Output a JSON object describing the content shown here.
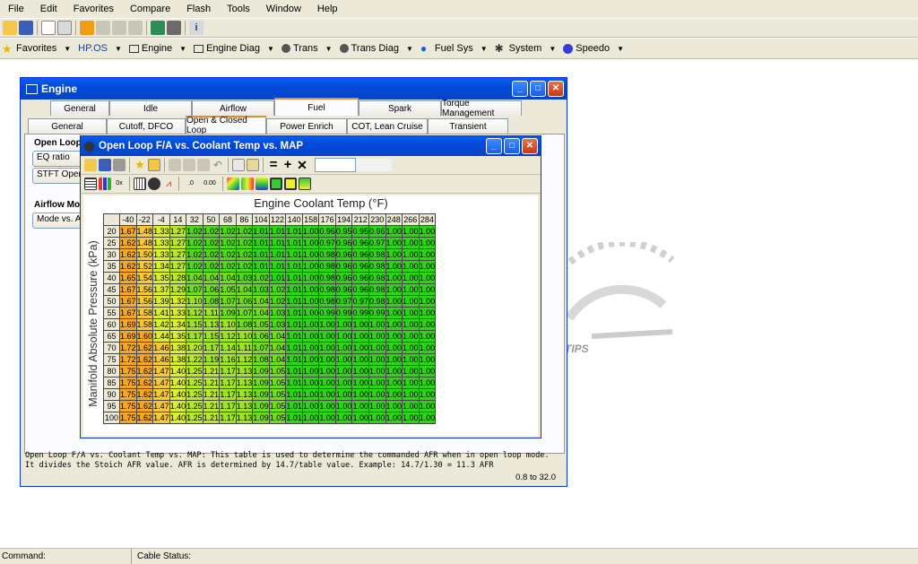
{
  "menu": [
    "File",
    "Edit",
    "Favorites",
    "Compare",
    "Flash",
    "Tools",
    "Window",
    "Help"
  ],
  "nav": [
    "Favorites",
    "HP.OS",
    "Engine",
    "Engine Diag",
    "Trans",
    "Trans Diag",
    "Fuel Sys",
    "System",
    "Speedo"
  ],
  "engine_window": {
    "title": "Engine",
    "tabs_main": [
      "General",
      "Idle",
      "Airflow",
      "Fuel",
      "Spark",
      "Torque Management"
    ],
    "active_main": "Fuel",
    "tabs_sub": [
      "General",
      "Cutoff, DFCO",
      "Open & Closed Loop",
      "Power Enrich",
      "COT, Lean Cruise",
      "Transient"
    ],
    "active_sub": "Open & Closed Loop",
    "section_open_loop": "Open Loop",
    "btn_eq_ratio": "EQ ratio",
    "btn_stft": "STFT Openlo",
    "section_airflow": "Airflow Mo",
    "btn_mode": "Mode vs. A",
    "description": "Open Loop F/A vs. Coolant Temp vs. MAP: This table is used to determine the commanded AFR when in open loop mode. It divides the Stoich AFR value. AFR is determined by 14.7/table value. Example: 14.7/1.30 = 11.3 AFR",
    "range": "0.8 to 32.0"
  },
  "table_window": {
    "title": "Open Loop F/A vs. Coolant Temp vs. MAP",
    "x_label": "Engine Coolant Temp (°F)",
    "y_label": "Manifold Absolute Pressure (kPa)",
    "columns": [
      "-40",
      "-22",
      "-4",
      "14",
      "32",
      "50",
      "68",
      "86",
      "104",
      "122",
      "140",
      "158",
      "176",
      "194",
      "212",
      "230",
      "248",
      "266",
      "284"
    ],
    "rows": [
      {
        "kpa": "20",
        "v": [
          "1.67",
          "1.48",
          "1.33",
          "1.27",
          "1.02",
          "1.02",
          "1.02",
          "1.02",
          "1.01",
          "1.01",
          "1.01",
          "1.00",
          "0.96",
          "0.95",
          "0.95",
          "0.96",
          "1.00",
          "1.00",
          "1.00"
        ]
      },
      {
        "kpa": "25",
        "v": [
          "1.62",
          "1.48",
          "1.33",
          "1.27",
          "1.02",
          "1.02",
          "1.02",
          "1.02",
          "1.01",
          "1.01",
          "1.01",
          "1.00",
          "0.97",
          "0.96",
          "0.96",
          "0.97",
          "1.00",
          "1.00",
          "1.00"
        ]
      },
      {
        "kpa": "30",
        "v": [
          "1.62",
          "1.50",
          "1.33",
          "1.27",
          "1.02",
          "1.02",
          "1.02",
          "1.02",
          "1.01",
          "1.01",
          "1.01",
          "1.00",
          "0.98",
          "0.96",
          "0.96",
          "0.98",
          "1.00",
          "1.00",
          "1.00"
        ]
      },
      {
        "kpa": "35",
        "v": [
          "1.62",
          "1.52",
          "1.34",
          "1.27",
          "1.02",
          "1.02",
          "1.02",
          "1.02",
          "1.01",
          "1.01",
          "1.01",
          "1.00",
          "0.98",
          "0.96",
          "0.96",
          "0.98",
          "1.00",
          "1.00",
          "1.00"
        ]
      },
      {
        "kpa": "40",
        "v": [
          "1.65",
          "1.54",
          "1.35",
          "1.28",
          "1.04",
          "1.04",
          "1.04",
          "1.03",
          "1.02",
          "1.01",
          "1.01",
          "1.00",
          "0.98",
          "0.96",
          "0.96",
          "0.98",
          "1.00",
          "1.00",
          "1.00"
        ]
      },
      {
        "kpa": "45",
        "v": [
          "1.67",
          "1.56",
          "1.37",
          "1.29",
          "1.07",
          "1.06",
          "1.05",
          "1.04",
          "1.03",
          "1.02",
          "1.01",
          "1.00",
          "0.98",
          "0.96",
          "0.96",
          "0.98",
          "1.00",
          "1.00",
          "1.00"
        ]
      },
      {
        "kpa": "50",
        "v": [
          "1.67",
          "1.56",
          "1.39",
          "1.32",
          "1.10",
          "1.08",
          "1.07",
          "1.06",
          "1.04",
          "1.02",
          "1.01",
          "1.00",
          "0.98",
          "0.97",
          "0.97",
          "0.98",
          "1.00",
          "1.00",
          "1.00"
        ]
      },
      {
        "kpa": "55",
        "v": [
          "1.67",
          "1.58",
          "1.41",
          "1.33",
          "1.12",
          "1.11",
          "1.09",
          "1.07",
          "1.04",
          "1.03",
          "1.01",
          "1.00",
          "0.99",
          "0.99",
          "0.99",
          "0.99",
          "1.00",
          "1.00",
          "1.00"
        ]
      },
      {
        "kpa": "60",
        "v": [
          "1.69",
          "1.58",
          "1.42",
          "1.34",
          "1.15",
          "1.13",
          "1.10",
          "1.08",
          "1.05",
          "1.03",
          "1.01",
          "1.00",
          "1.00",
          "1.00",
          "1.00",
          "1.00",
          "1.00",
          "1.00",
          "1.00"
        ]
      },
      {
        "kpa": "65",
        "v": [
          "1.69",
          "1.60",
          "1.44",
          "1.35",
          "1.17",
          "1.15",
          "1.12",
          "1.10",
          "1.06",
          "1.04",
          "1.01",
          "1.00",
          "1.00",
          "1.00",
          "1.00",
          "1.00",
          "1.00",
          "1.00",
          "1.00"
        ]
      },
      {
        "kpa": "70",
        "v": [
          "1.72",
          "1.62",
          "1.46",
          "1.38",
          "1.20",
          "1.17",
          "1.14",
          "1.11",
          "1.07",
          "1.04",
          "1.01",
          "1.00",
          "1.00",
          "1.00",
          "1.00",
          "1.00",
          "1.00",
          "1.00",
          "1.00"
        ]
      },
      {
        "kpa": "75",
        "v": [
          "1.72",
          "1.62",
          "1.46",
          "1.38",
          "1.22",
          "1.19",
          "1.16",
          "1.12",
          "1.08",
          "1.04",
          "1.01",
          "1.00",
          "1.00",
          "1.00",
          "1.00",
          "1.00",
          "1.00",
          "1.00",
          "1.00"
        ]
      },
      {
        "kpa": "80",
        "v": [
          "1.75",
          "1.62",
          "1.47",
          "1.40",
          "1.25",
          "1.21",
          "1.17",
          "1.13",
          "1.09",
          "1.05",
          "1.01",
          "1.00",
          "1.00",
          "1.00",
          "1.00",
          "1.00",
          "1.00",
          "1.00",
          "1.00"
        ]
      },
      {
        "kpa": "85",
        "v": [
          "1.75",
          "1.62",
          "1.47",
          "1.40",
          "1.25",
          "1.21",
          "1.17",
          "1.13",
          "1.09",
          "1.05",
          "1.01",
          "1.00",
          "1.00",
          "1.00",
          "1.00",
          "1.00",
          "1.00",
          "1.00",
          "1.00"
        ]
      },
      {
        "kpa": "90",
        "v": [
          "1.75",
          "1.62",
          "1.47",
          "1.40",
          "1.25",
          "1.21",
          "1.17",
          "1.13",
          "1.09",
          "1.05",
          "1.01",
          "1.00",
          "1.00",
          "1.00",
          "1.00",
          "1.00",
          "1.00",
          "1.00",
          "1.00"
        ]
      },
      {
        "kpa": "95",
        "v": [
          "1.75",
          "1.62",
          "1.47",
          "1.40",
          "1.25",
          "1.21",
          "1.17",
          "1.13",
          "1.09",
          "1.05",
          "1.01",
          "1.00",
          "1.00",
          "1.00",
          "1.00",
          "1.00",
          "1.00",
          "1.00",
          "1.00"
        ]
      },
      {
        "kpa": "100",
        "v": [
          "1.75",
          "1.62",
          "1.47",
          "1.40",
          "1.25",
          "1.21",
          "1.17",
          "1.13",
          "1.09",
          "1.05",
          "1.01",
          "1.00",
          "1.00",
          "1.00",
          "1.00",
          "1.00",
          "1.00",
          "1.00",
          "1.00"
        ]
      }
    ],
    "value_textbox": ""
  },
  "status": {
    "command_label": "Command:",
    "cable_label": "Cable Status:"
  },
  "watermark_text": "TIPS",
  "colors": {
    "xp_blue": "#0349d8",
    "face": "#ece9d8",
    "hot": "#f5a623",
    "mid": "#e6f03a",
    "cool": "#22d916"
  }
}
